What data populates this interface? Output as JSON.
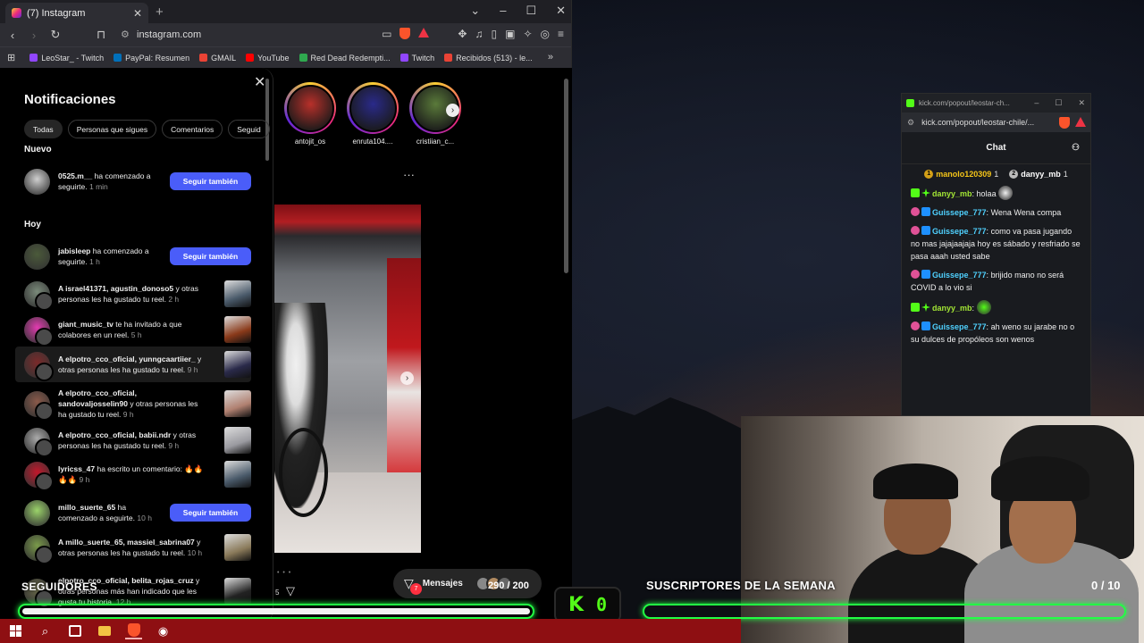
{
  "browser": {
    "tab_title": "(7) Instagram",
    "url": "instagram.com",
    "bookmarks": [
      {
        "label": "LeoStar_ - Twitch",
        "color": "#9146ff"
      },
      {
        "label": "PayPal: Resumen",
        "color": "#0070ba"
      },
      {
        "label": "GMAIL",
        "color": "#ea4335"
      },
      {
        "label": "YouTube",
        "color": "#ff0000"
      },
      {
        "label": "Red Dead Redempti...",
        "color": "#2fa84f"
      },
      {
        "label": "Twitch",
        "color": "#9146ff"
      },
      {
        "label": "Recibidos (513) - le...",
        "color": "#ea4335"
      }
    ]
  },
  "notifications": {
    "title": "Notificaciones",
    "chips": [
      "Todas",
      "Personas que sigues",
      "Comentarios",
      "Seguid"
    ],
    "section_new": "Nuevo",
    "section_today": "Hoy",
    "follow_label": "Seguir también",
    "items": [
      {
        "user": "0525.m__",
        "text": " ha comenzado a seguirte.",
        "time": "1 min",
        "button": true,
        "avatar": "#cfcfcf"
      },
      {
        "user": "jabisleep",
        "text": " ha comenzado a seguirte.",
        "time": "1 h",
        "button": true,
        "avatar": "#4b5a3a"
      },
      {
        "user": "A israel41371, agustin_donoso5",
        "text": " y otras personas les ha gustado tu reel.",
        "time": "2 h",
        "button": false,
        "avatar": "#7a8a7a",
        "thumb": "#4a5a6a"
      },
      {
        "user": "giant_music_tv",
        "text": " te ha invitado a que colabores en un reel.",
        "time": "5 h",
        "button": false,
        "avatar": "#e23bb0",
        "thumb": "#8a3a1a"
      },
      {
        "user": "A elpotro_cco_oficial, yunngcaartiier_",
        "text": " y otras personas les ha gustado tu reel.",
        "time": "9 h",
        "button": false,
        "avatar": "#7a2a2a",
        "thumb": "#2a2a4a"
      },
      {
        "user": "A elpotro_cco_oficial, sandovaljosselin90",
        "text": " y otras personas les ha gustado tu reel.",
        "time": "9 h",
        "button": false,
        "avatar": "#8a5a4a",
        "thumb": "#b08070"
      },
      {
        "user": "A elpotro_cco_oficial, babii.ndr",
        "text": " y otras personas les ha gustado tu reel.",
        "time": "9 h",
        "button": false,
        "avatar": "#aaaaaa",
        "thumb": "#9a9aa0"
      },
      {
        "user": "lyricss_47",
        "text": " ha escrito un comentario: 🔥🔥🔥🔥",
        "time": "9 h",
        "button": false,
        "avatar": "#c2182b",
        "thumb": "#4a5a6a"
      },
      {
        "user": "millo_suerte_65",
        "text": " ha comenzado a seguirte.",
        "time": "10 h",
        "button": true,
        "avatar": "#9bd36a"
      },
      {
        "user": "A millo_suerte_65, massiel_sabrina07",
        "text": " y otras personas les ha gustado tu reel.",
        "time": "10 h",
        "button": false,
        "avatar": "#7a9a4a",
        "thumb": "#8a7a5a"
      },
      {
        "user": "elpotro_cco_oficial, belita_rojas_cruz",
        "text": " y otras personas más han indicado que les gusta tu historia.",
        "time": "12 h",
        "button": false,
        "avatar": "#6a6a4a",
        "thumb": "#222222"
      }
    ]
  },
  "feed": {
    "stories": [
      {
        "name": "antojit_os",
        "color": "#b8302a"
      },
      {
        "name": "enruta104....",
        "color": "#2a2a8a"
      },
      {
        "name": "cristiian_c...",
        "color": "#5a7a3a"
      }
    ],
    "messages_label": "Mensajes",
    "messages_badge": "7",
    "likes_count": "5"
  },
  "overlay": {
    "followers_label": "SEGUIDORES",
    "followers_progress": "290 / 200",
    "subs_label": "SUSCRIPTORES DE LA SEMANA",
    "subs_progress": "0 / 10",
    "kick_letter": "K",
    "kick_count": "0",
    "accent": "#22ff44"
  },
  "chat": {
    "window_title": "kick.com/popout/leostar-ch...",
    "url": "kick.com/popout/leostar-chile/...",
    "header": "Chat",
    "leaders": [
      {
        "rank": "1",
        "name": "manolo120309",
        "count": "1",
        "color": "#f5c518"
      },
      {
        "rank": "2",
        "name": "danyy_mb",
        "count": "1",
        "color": "#ffffff"
      }
    ],
    "messages": [
      {
        "user": "danyy_mb",
        "text": " holaa",
        "color": "#a3e635",
        "badges": [
          "green",
          "star"
        ],
        "emote": "#f0f0f0"
      },
      {
        "user": "Guissepe_777",
        "text": " Wena Wena compa",
        "color": "#4fd1ff",
        "badges": [
          "pink",
          "blue"
        ]
      },
      {
        "user": "Guissepe_777",
        "text": " como va pasa jugando no mas jajajaajaja hoy es sábado y resfriado se pasa aaah usted sabe",
        "color": "#4fd1ff",
        "badges": [
          "pink",
          "blue"
        ]
      },
      {
        "user": "Guissepe_777",
        "text": " brijido mano no será COVID a lo vio si",
        "color": "#4fd1ff",
        "badges": [
          "pink",
          "blue"
        ]
      },
      {
        "user": "danyy_mb",
        "text": "",
        "color": "#a3e635",
        "badges": [
          "green",
          "star"
        ],
        "emote": "#53fc18"
      },
      {
        "user": "Guissepe_777",
        "text": " ah weno su jarabe no o su dulces de propóleos son wenos",
        "color": "#4fd1ff",
        "badges": [
          "pink",
          "blue"
        ]
      }
    ]
  }
}
